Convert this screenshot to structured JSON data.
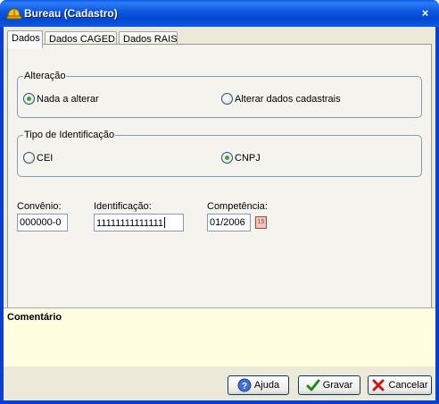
{
  "window": {
    "title": "Bureau (Cadastro)",
    "close": "×"
  },
  "tabs": [
    {
      "label": "Dados"
    },
    {
      "label": "Dados CAGED"
    },
    {
      "label": "Dados RAIS"
    }
  ],
  "alteracao": {
    "title": "Alteração",
    "options": [
      {
        "label": "Nada a alterar",
        "selected": true
      },
      {
        "label": "Alterar dados cadastrais",
        "selected": false
      }
    ]
  },
  "tipo_identificacao": {
    "title": "Tipo de Identificação",
    "options": [
      {
        "label": "CEI",
        "selected": false
      },
      {
        "label": "CNPJ",
        "selected": true
      }
    ]
  },
  "fields": {
    "convenio": {
      "label": "Convênio:",
      "value": "000000-0"
    },
    "identificacao": {
      "label": "Identificação:",
      "value": "11111111111111"
    },
    "competencia": {
      "label": "Competência:",
      "value": "01/2006"
    },
    "calendar_icon_text": "15"
  },
  "comentario": {
    "label": "Comentário"
  },
  "buttons": {
    "help": "Ajuda",
    "save": "Gravar",
    "cancel": "Cancelar"
  },
  "icons": {
    "title": "hardhat-icon",
    "calendar": "calendar-icon",
    "help": "help-icon",
    "save": "checkmark-icon",
    "cancel": "x-icon"
  },
  "colors": {
    "titlebar": "#0b55dd",
    "client": "#ece9d8",
    "comment_bg": "#fffee1",
    "radio_on": "#3ba53b"
  }
}
